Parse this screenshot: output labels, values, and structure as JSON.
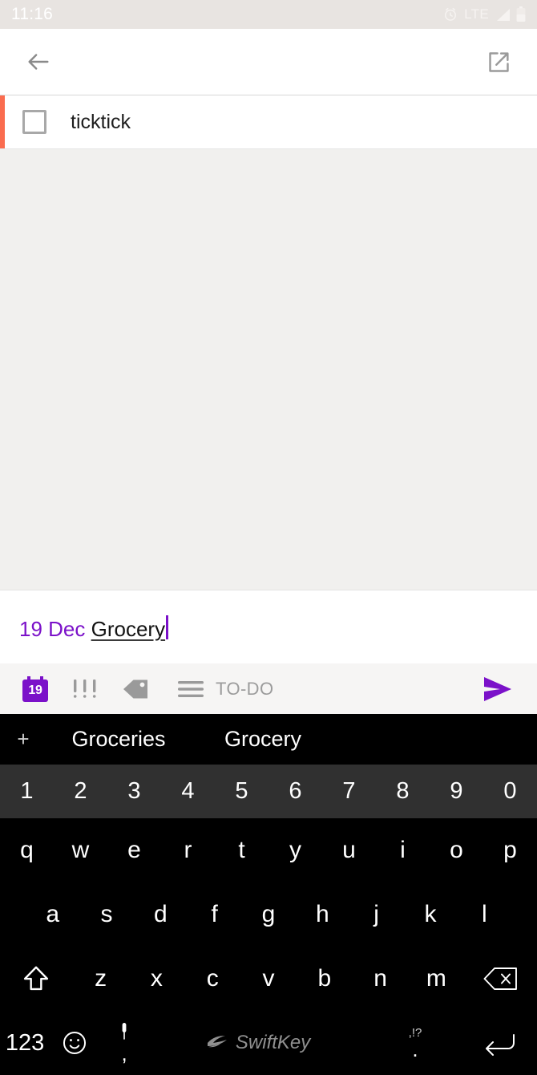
{
  "status_bar": {
    "time": "11:16",
    "network_label": "LTE",
    "icons": [
      "alarm-clock-icon",
      "signal-icon",
      "battery-icon"
    ],
    "background": "#e8e4e1",
    "text_color": "#ffffff"
  },
  "app_bar": {
    "back_icon": "arrow-left-icon",
    "open_external_icon": "open-in-new-icon",
    "background": "#ffffff"
  },
  "task": {
    "title": "ticktick",
    "checkbox_checked": false,
    "accent_color": "#fa6c4f"
  },
  "note_area": {
    "content": "",
    "background": "#f1f0ee"
  },
  "edit_field": {
    "date_token": "19 Dec",
    "date_token_color": "#7b11c9",
    "text": "Grocery",
    "caret_visible": true
  },
  "attribute_toolbar": {
    "background": "#f6f5f4",
    "date_badge_day": "19",
    "date_badge_color": "#7b11c9",
    "priority_icon": "priority-exclamations-icon",
    "tag_icon": "tag-icon",
    "list_icon": "list-lines-icon",
    "list_label": "TO-DO",
    "send_icon": "send-icon",
    "send_color": "#7b11c9"
  },
  "keyboard": {
    "suggestions": {
      "add_icon": "plus-icon",
      "items": [
        "Groceries",
        "Grocery"
      ]
    },
    "number_row": [
      "1",
      "2",
      "3",
      "4",
      "5",
      "6",
      "7",
      "8",
      "9",
      "0"
    ],
    "row1": [
      "q",
      "w",
      "e",
      "r",
      "t",
      "y",
      "u",
      "i",
      "o",
      "p"
    ],
    "row2": [
      "a",
      "s",
      "d",
      "f",
      "g",
      "h",
      "j",
      "k",
      "l"
    ],
    "row3": {
      "shift_icon": "shift-up-icon",
      "keys": [
        "z",
        "x",
        "c",
        "v",
        "b",
        "n",
        "m"
      ],
      "backspace_icon": "backspace-icon"
    },
    "bottom_row": {
      "numeric_label": "123",
      "emoji_icon": "smiley-icon",
      "mic_icon": "microphone-icon",
      "comma_label": ",",
      "space_brand": "SwiftKey",
      "space_brand_icon": "swiftkey-logo-icon",
      "punct_label": ",!?",
      "period_label": ".",
      "enter_icon": "enter-return-icon"
    },
    "background": "#000000",
    "number_row_background": "#303030",
    "key_text_color": "#ffffff"
  }
}
